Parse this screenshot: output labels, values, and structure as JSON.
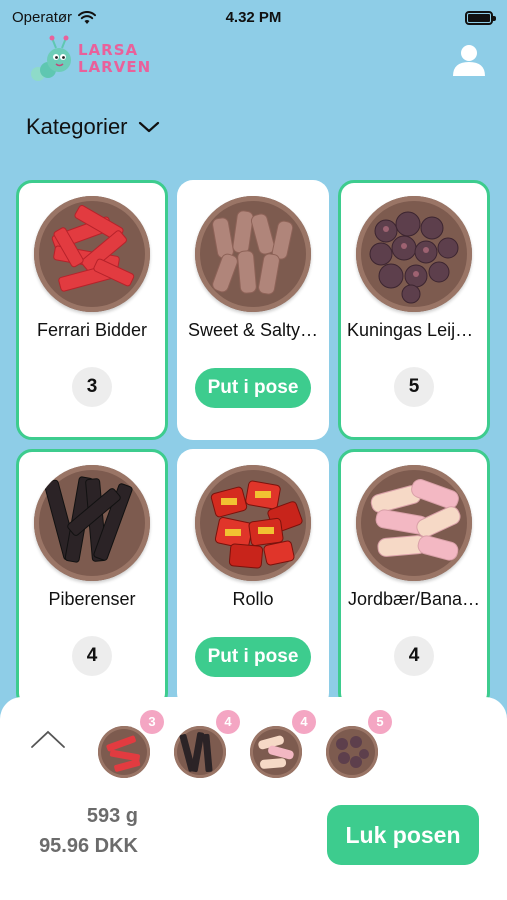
{
  "status_bar": {
    "carrier": "Operatør",
    "time": "4.32 PM"
  },
  "header": {
    "brand_line1": "LARSA",
    "brand_line2": "LARVEN"
  },
  "category_select": {
    "label": "Kategorier"
  },
  "candies": [
    {
      "name": "Ferrari Bidder",
      "quantity": "3",
      "selected": true,
      "color": "#e03a3e"
    },
    {
      "name": "Sweet & Salty…",
      "button_label": "Put i pose",
      "selected": false,
      "color": "#a4776a"
    },
    {
      "name": "Kuningas Leijo…",
      "quantity": "5",
      "selected": true,
      "color": "#5a3d4a"
    },
    {
      "name": "Piberenser",
      "quantity": "4",
      "selected": true,
      "color": "#2a2325"
    },
    {
      "name": "Rollo",
      "button_label": "Put i pose",
      "selected": false,
      "color": "#d42b1f"
    },
    {
      "name": "Jordbær/Bana…",
      "quantity": "4",
      "selected": true,
      "color": "#f3c3ca"
    }
  ],
  "bag": {
    "items": [
      {
        "name": "Ferrari Bidder",
        "count": "3"
      },
      {
        "name": "Piberenser",
        "count": "4"
      },
      {
        "name": "Jordbær/Banan",
        "count": "4"
      },
      {
        "name": "Kuningas Leijona",
        "count": "5"
      }
    ],
    "weight": "593 g",
    "price": "95.96 DKK",
    "close_label": "Luk posen"
  },
  "colors": {
    "accent": "#3dcc8e",
    "background": "#8ecde7",
    "badge": "#f4a6c3",
    "brand": "#e9619b"
  }
}
